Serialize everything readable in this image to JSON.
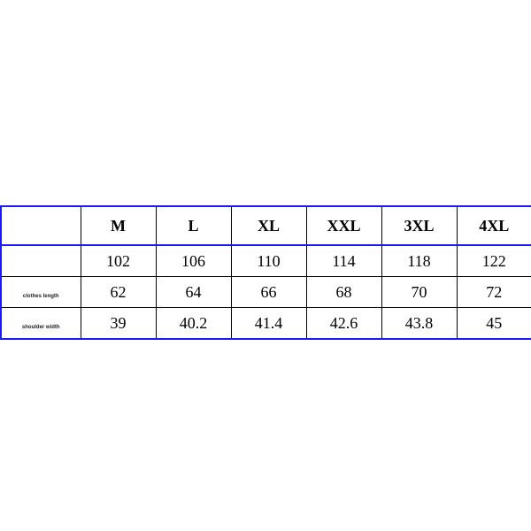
{
  "chart_data": {
    "type": "table",
    "title": "",
    "columns": [
      "M",
      "L",
      "XL",
      "XXL",
      "3XL",
      "4XL"
    ],
    "rows": [
      {
        "label": "",
        "values": [
          102,
          106,
          110,
          114,
          118,
          122
        ]
      },
      {
        "label": "clothes length",
        "values": [
          62,
          64,
          66,
          68,
          70,
          72
        ]
      },
      {
        "label": "shoulder width",
        "values": [
          39,
          40.2,
          41.4,
          42.6,
          43.8,
          45
        ]
      }
    ]
  }
}
